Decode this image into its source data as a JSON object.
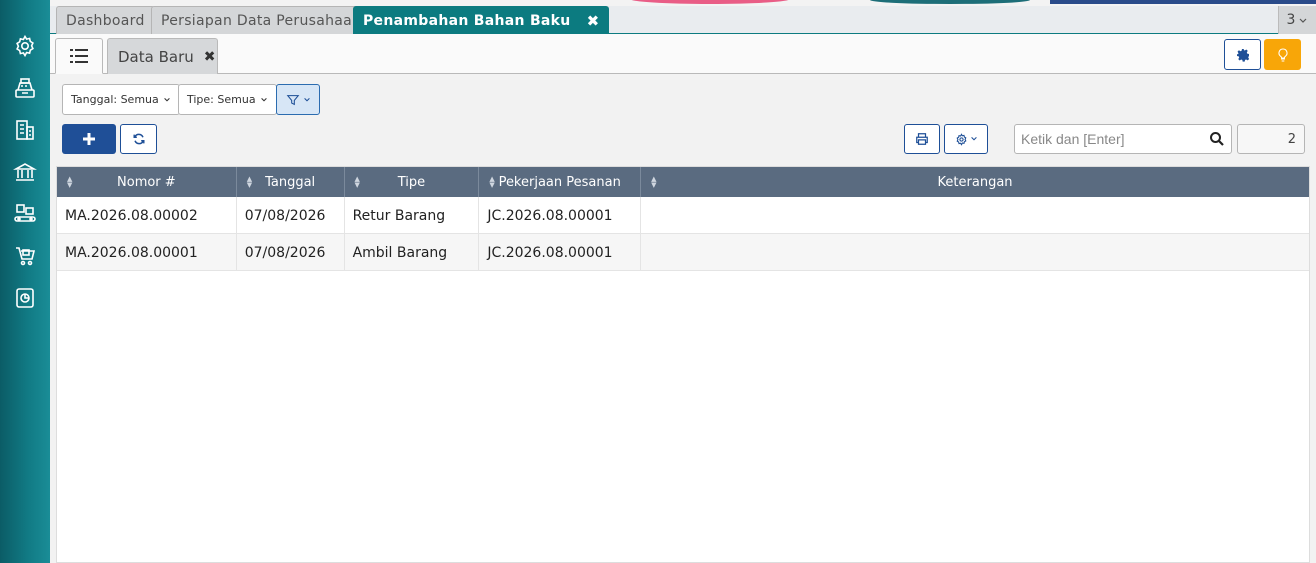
{
  "tabs": [
    {
      "label": "Dashboard"
    },
    {
      "label": "Persiapan Data Perusahaan"
    },
    {
      "label": "Penambahan Bahan Baku"
    }
  ],
  "tab_count": "3",
  "subtab": {
    "label": "Data Baru"
  },
  "filters": {
    "tanggal": "Tanggal: Semua",
    "tipe": "Tipe: Semua"
  },
  "search": {
    "placeholder": "Ketik dan [Enter]"
  },
  "record_count": "2",
  "table": {
    "columns": [
      "Nomor #",
      "Tanggal",
      "Tipe",
      "Pekerjaan Pesanan",
      "Keterangan"
    ],
    "rows": [
      [
        "MA.2026.08.00002",
        "07/08/2026",
        "Retur Barang",
        "JC.2026.08.00001",
        ""
      ],
      [
        "MA.2026.08.00001",
        "07/08/2026",
        "Ambil Barang",
        "JC.2026.08.00001",
        ""
      ]
    ]
  },
  "colors": {
    "sidebar": "#117a84",
    "active_tab": "#0c7b80",
    "primary": "#1f4f97",
    "table_header": "#5a6b80",
    "bulb_button": "#f8a608"
  },
  "icons": {
    "sidebar": [
      "gear-icon",
      "cash-register-icon",
      "building-icon",
      "bank-icon",
      "conveyor-icon",
      "cart-icon",
      "report-icon"
    ]
  }
}
